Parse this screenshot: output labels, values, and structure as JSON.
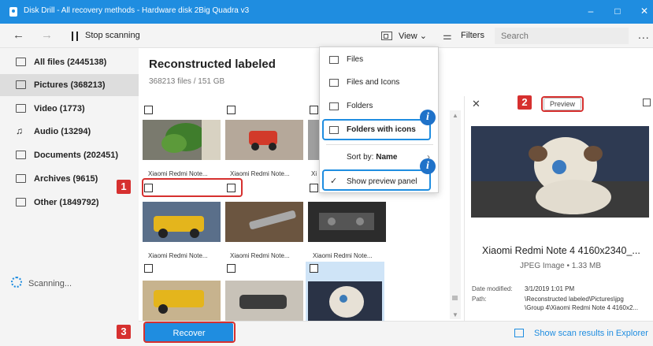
{
  "window": {
    "title": "Disk Drill - All recovery methods - Hardware disk 2Big Quadra v3",
    "minimize": "–",
    "maximize": "□",
    "close": "✕"
  },
  "toolbar": {
    "back": "←",
    "forward": "→",
    "stop_label": "Stop scanning",
    "view_label": "View ⌄",
    "filters_label": "Filters",
    "search_placeholder": "Search",
    "more": "..."
  },
  "sidebar": {
    "items": [
      {
        "label": "All files (2445138)",
        "icon": "all-files-icon"
      },
      {
        "label": "Pictures (368213)",
        "icon": "pictures-icon",
        "active": true
      },
      {
        "label": "Video (1773)",
        "icon": "video-icon"
      },
      {
        "label": "Audio (13294)",
        "icon": "audio-icon"
      },
      {
        "label": "Documents (202451)",
        "icon": "documents-icon"
      },
      {
        "label": "Archives (9615)",
        "icon": "archives-icon"
      },
      {
        "label": "Other (1849792)",
        "icon": "other-icon"
      }
    ],
    "status": "Scanning..."
  },
  "main": {
    "title": "Reconstructed labeled",
    "subtitle": "368213 files / 151 GB",
    "captions": [
      "Xiaomi Redmi Note...",
      "Xiaomi Redmi Note...",
      "Xi",
      "Xiaomi Redmi Note...",
      "Xiaomi Redmi Note...",
      "Xiaomi Redmi Note..."
    ]
  },
  "view_menu": {
    "items": [
      {
        "label": "Files",
        "icon": "list-icon"
      },
      {
        "label": "Files and Icons",
        "icon": "files-icons-icon"
      },
      {
        "label": "Folders",
        "icon": "folder-icon"
      },
      {
        "label": "Folders with icons",
        "icon": "folder-icons-icon",
        "selected": true
      },
      {
        "label": "Sort by:",
        "value": "Name"
      },
      {
        "label": "Show preview panel",
        "checked": true
      }
    ],
    "chevron": "›",
    "check": "✓"
  },
  "preview": {
    "close": "✕",
    "button_label": "Preview",
    "filename": "Xiaomi Redmi Note 4 4160x2340_...",
    "filetype": "JPEG Image • 1.33 MB",
    "date_label": "Date modified:",
    "date_value": "3/1/2019 1:01 PM",
    "path_label": "Path:",
    "path_line1": "\\Reconstructed labeled\\Pictures\\jpg",
    "path_line2": "\\Group 4\\Xiaomi Redmi Note 4 4160x2..."
  },
  "bottom": {
    "recover_label": "Recover",
    "explorer_label": "Show scan results in Explorer"
  },
  "annotations": {
    "badge1": "1",
    "badge2": "2",
    "badge3": "3",
    "info": "i"
  },
  "colors": {
    "accent": "#1f8de0",
    "annotation_red": "#d6302f",
    "selected_row": "#cfe4f7"
  }
}
